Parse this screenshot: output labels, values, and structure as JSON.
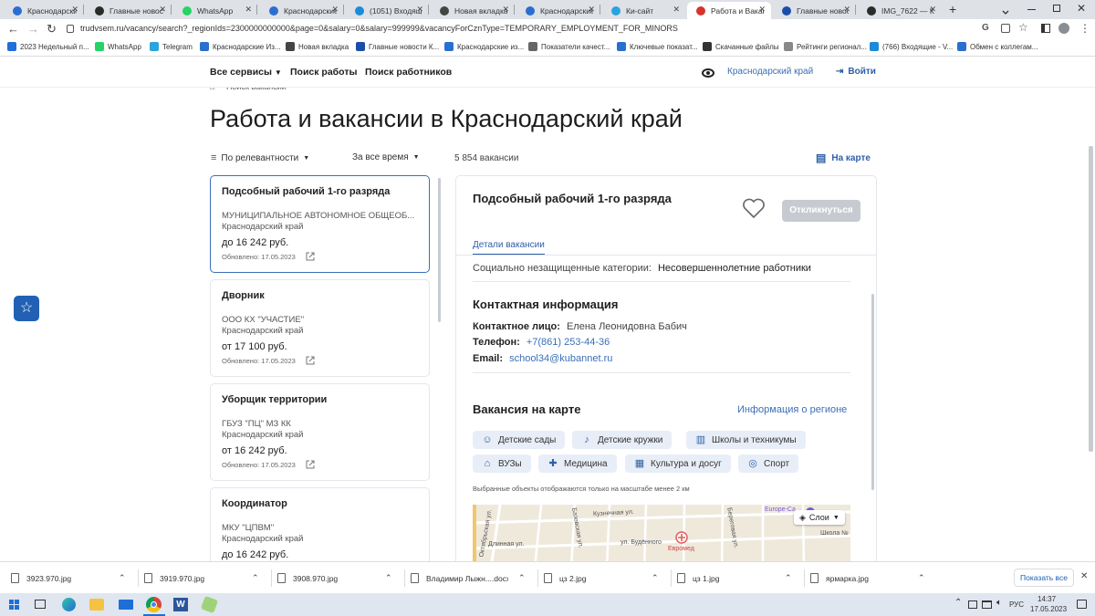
{
  "browser": {
    "tabs": [
      {
        "title": "Краснодарские",
        "icon_color": "#2a6fd0"
      },
      {
        "title": "Главные новос",
        "icon_color": "#2b2b2b"
      },
      {
        "title": "WhatsApp",
        "icon_color": "#25d366"
      },
      {
        "title": "Краснодарские",
        "icon_color": "#2a6fd0"
      },
      {
        "title": "(1051) Входящ",
        "icon_color": "#1a8cd8"
      },
      {
        "title": "Новая вкладка",
        "icon_color": "#444444"
      },
      {
        "title": "Краснодарские",
        "icon_color": "#2a6fd0"
      },
      {
        "title": "Ки-сайт",
        "icon_color": "#2aa3de"
      },
      {
        "title": "Работа и Вакан",
        "icon_color": "#d6342c"
      },
      {
        "title": "Главные новос",
        "icon_color": "#1a4ea8"
      },
      {
        "title": "IMG_7622 — Кр",
        "icon_color": "#2b2b2b"
      }
    ],
    "active_tab_index": 8,
    "new_tab_label": "+",
    "url": "trudvsem.ru/vacancy/search?_regionIds=2300000000000&page=0&salary=0&salary=999999&vacancyForCznType=TEMPORARY_EMPLOYMENT_FOR_MINORS",
    "bookmarks": [
      {
        "label": "2023 Недельный п...",
        "icon_color": "#1e6fd9"
      },
      {
        "label": "WhatsApp",
        "icon_color": "#25d366"
      },
      {
        "label": "Telegram",
        "icon_color": "#2aa3de"
      },
      {
        "label": "Краснодарские Из...",
        "icon_color": "#2a6fd0"
      },
      {
        "label": "Новая вкладка",
        "icon_color": "#444444"
      },
      {
        "label": "Главные новости К...",
        "icon_color": "#1a4ea8"
      },
      {
        "label": "Краснодарские из...",
        "icon_color": "#2a6fd0"
      },
      {
        "label": "Показатели качест...",
        "icon_color": "#666666"
      },
      {
        "label": "Ключевые показат...",
        "icon_color": "#2a6fd0"
      },
      {
        "label": "Скачанные файлы",
        "icon_color": "#333333"
      },
      {
        "label": "Рейтинги регионал...",
        "icon_color": "#888888"
      },
      {
        "label": "(766) Входящие - V...",
        "icon_color": "#1a8cd8"
      },
      {
        "label": "Обмен с коллегам...",
        "icon_color": "#2a6fd0"
      }
    ]
  },
  "site": {
    "nav": {
      "all_services": "Все сервисы",
      "job_search": "Поиск работы",
      "worker_search": "Поиск работников",
      "region": "Краснодарский край",
      "login": "Войти"
    },
    "breadcrumb": "Поиск вакансий",
    "page_title": "Работа и вакансии в Краснодарский край",
    "filters": {
      "sort": "По релевантности",
      "period": "За все время",
      "count": "5 854 вакансии",
      "map_link": "На карте"
    },
    "vacancies": [
      {
        "title": "Подсобный рабочий 1-го разряда",
        "org": "МУНИЦИПАЛЬНОЕ АВТОНОМНОЕ ОБЩЕОБ...",
        "region": "Краснодарский край",
        "salary": "до 16 242 руб.",
        "updated": "Обновлено: 17.05.2023"
      },
      {
        "title": "Дворник",
        "org": "ООО КХ \"УЧАСТИЕ\"",
        "region": "Краснодарский край",
        "salary": "от 17 100 руб.",
        "updated": "Обновлено: 17.05.2023"
      },
      {
        "title": "Уборщик территории",
        "org": "ГБУЗ \"ПЦ\" МЗ КК",
        "region": "Краснодарский край",
        "salary": "от 16 242 руб.",
        "updated": "Обновлено: 17.05.2023"
      },
      {
        "title": "Координатор",
        "org": "МКУ \"ЦПВМ\"",
        "region": "Краснодарский край",
        "salary": "до 16 242 руб.",
        "updated": ""
      }
    ],
    "detail": {
      "title": "Подсобный рабочий 1-го разряда",
      "respond_button": "Откликнуться",
      "tab_details": "Детали вакансии",
      "social_label": "Социально незащищенные категории:",
      "social_value": "Несовершеннолетние работники",
      "contact_heading": "Контактная информация",
      "contact_person_label": "Контактное лицо:",
      "contact_person_value": "Елена Леонидовна Бабич",
      "phone_label": "Телефон:",
      "phone_value": "+7(861) 253-44-36",
      "email_label": "Email:",
      "email_value": "school34@kubannet.ru",
      "map_heading": "Вакансия на карте",
      "region_info_link": "Информация о регионе",
      "map_filters": [
        {
          "label": "Детские сады",
          "icon": "kindergarten-icon",
          "glyph": "☺"
        },
        {
          "label": "Детские кружки",
          "icon": "children-clubs-icon",
          "glyph": "♪"
        },
        {
          "label": "Школы и техникумы",
          "icon": "school-icon",
          "glyph": "▥"
        },
        {
          "label": "ВУЗы",
          "icon": "university-icon",
          "glyph": "⌂"
        },
        {
          "label": "Медицина",
          "icon": "medicine-icon",
          "glyph": "✚"
        },
        {
          "label": "Культура и досуг",
          "icon": "culture-icon",
          "glyph": "▦"
        },
        {
          "label": "Спорт",
          "icon": "sport-icon",
          "glyph": "◎"
        }
      ],
      "map_note": "Выбранные объекты отображаются только на масштабе менее 2 км",
      "map_layers_label": "Слои",
      "map_labels": {
        "street_1": "Кузнечная ул.",
        "street_2": "Длинная ул.",
        "street_3": "ул. Будённого",
        "street_4": "Базовская ул.",
        "street_5": "Береговая ул.",
        "place_1": "Евромед",
        "place_2": "Europe-Ca",
        "place_3": "Школа №",
        "street_6": "Октябрьская ул."
      }
    }
  },
  "downloads": {
    "items": [
      "3923.970.jpg",
      "3919.970.jpg",
      "3908.970.jpg",
      "Владимир Лыжн....docx",
      "цз 2.jpg",
      "цз 1.jpg",
      "ярмарка.jpg"
    ],
    "show_all": "Показать все"
  },
  "taskbar": {
    "lang": "РУС",
    "time": "14:37",
    "date": "17.05.2023"
  },
  "colors": {
    "accent": "#2f5ea8",
    "link": "#3b6fb6",
    "button_disabled": "#c7cbd1",
    "pill_bg": "#e8eef7",
    "favorite_fab": "#2160b4"
  }
}
